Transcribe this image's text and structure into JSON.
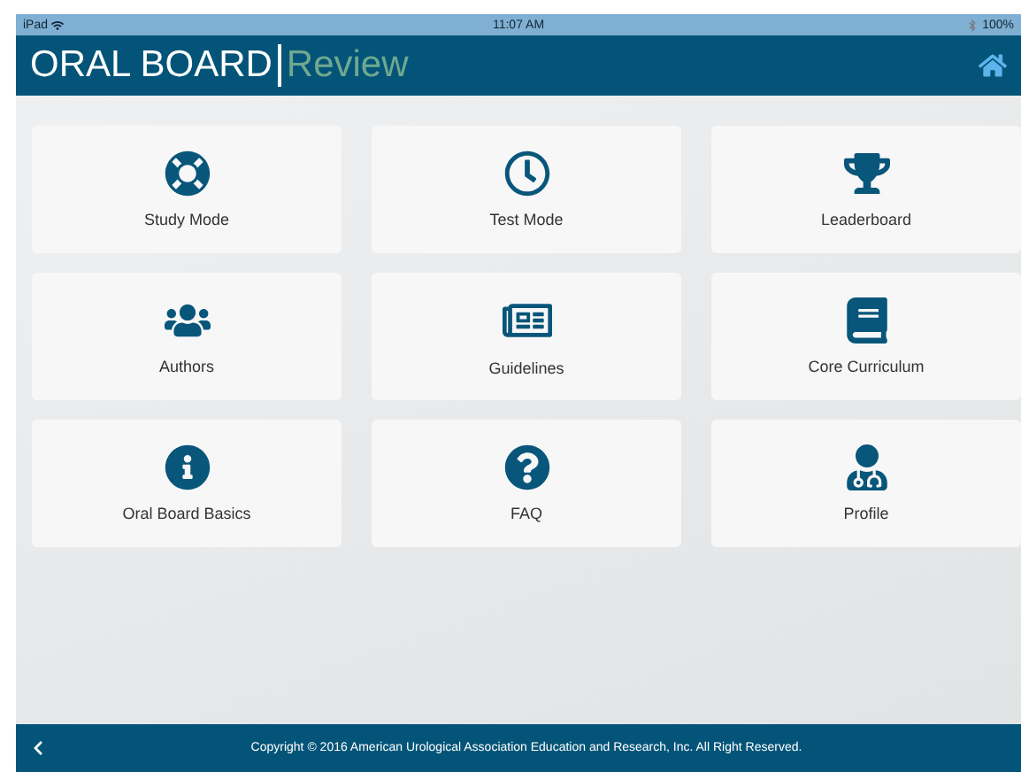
{
  "status_bar": {
    "device": "iPad",
    "time": "11:07 AM",
    "battery": "100%"
  },
  "header": {
    "title": "ORAL BOARD",
    "subtitle": "Review"
  },
  "tiles": [
    {
      "label": "Study Mode"
    },
    {
      "label": "Test Mode"
    },
    {
      "label": "Leaderboard"
    },
    {
      "label": "Authors"
    },
    {
      "label": "Guidelines"
    },
    {
      "label": "Core Curriculum"
    },
    {
      "label": "Oral Board Basics"
    },
    {
      "label": "FAQ"
    },
    {
      "label": "Profile"
    }
  ],
  "footer": {
    "copyright": "Copyright © 2016 American Urological Association Education and Research, Inc. All Right Reserved."
  }
}
